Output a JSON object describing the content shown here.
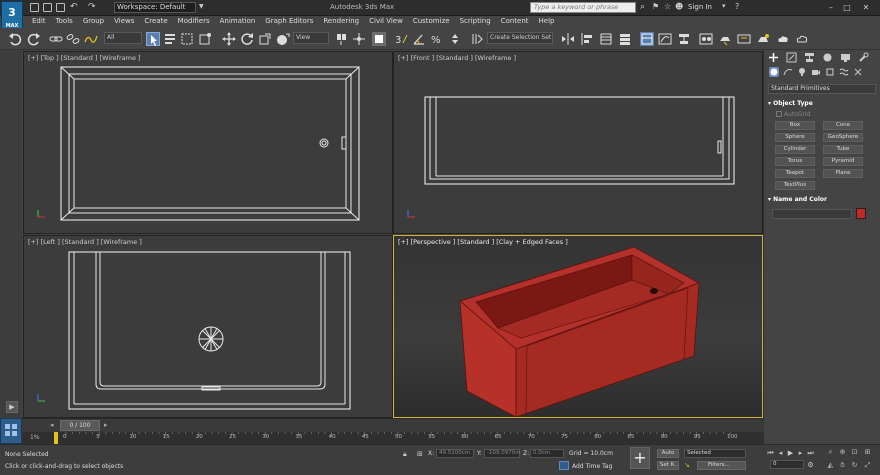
{
  "app": {
    "logo_text": "3",
    "logo_sub": "MAX",
    "title": "Autodesk 3ds Max",
    "workspace_label": "Workspace: Default",
    "search_placeholder": "Type a keyword or phrase",
    "signin_label": "Sign In"
  },
  "menu": {
    "items": [
      "Edit",
      "Tools",
      "Group",
      "Views",
      "Create",
      "Modifiers",
      "Animation",
      "Graph Editors",
      "Rendering",
      "Civil View",
      "Customize",
      "Scripting",
      "Content",
      "Help"
    ]
  },
  "toolbar": {
    "filter_value": "All",
    "view_value": "View",
    "selection_set_placeholder": "Create Selection Set"
  },
  "viewports": {
    "top": "[+] [Top ] [Standard ] [Wireframe ]",
    "front": "[+] [Front ] [Standard ] [Wireframe ]",
    "left": "[+] [Left ] [Standard ] [Wireframe ]",
    "perspective": "[+] [Perspective ] [Standard ] [Clay + Edged Faces ]"
  },
  "command_panel": {
    "category": "Standard Primitives",
    "object_type_title": "Object Type",
    "autogrid_label": "AutoGrid",
    "object_buttons": [
      "Box",
      "Cone",
      "Sphere",
      "GeoSphere",
      "Cylinder",
      "Tube",
      "Torus",
      "Pyramid",
      "Teapot",
      "Plane",
      "TextPlus"
    ],
    "name_color_title": "Name and Color",
    "object_color": "#c62828"
  },
  "timeline": {
    "frame_display": "0 / 100",
    "ruler_ticks": [
      "0",
      "5",
      "10",
      "15",
      "20",
      "25",
      "30",
      "35",
      "40",
      "45",
      "50",
      "55",
      "60",
      "65",
      "70",
      "75",
      "80",
      "85",
      "90",
      "95",
      "100"
    ],
    "start_marker": "1%"
  },
  "status": {
    "selection": "None Selected",
    "prompt": "Click or click-and-drag to select objects",
    "x_label": "X:",
    "x_value": "49.5100cm",
    "y_label": "Y:",
    "y_value": "-109.0970m",
    "z_label": "Z:",
    "z_value": "0.0cm",
    "grid": "Grid = 10.0cm",
    "add_time_tag": "Add Time Tag",
    "auto_label": "Auto",
    "setk_label": "Set K.",
    "selected_value": "Selected",
    "filters_label": "Filters...",
    "current_frame": "0"
  },
  "colors": {
    "accent_blue": "#1d6fa5",
    "active_viewport_border": "#d2b33a",
    "time_key": "#e4c21c",
    "object_red": "#c62828"
  }
}
